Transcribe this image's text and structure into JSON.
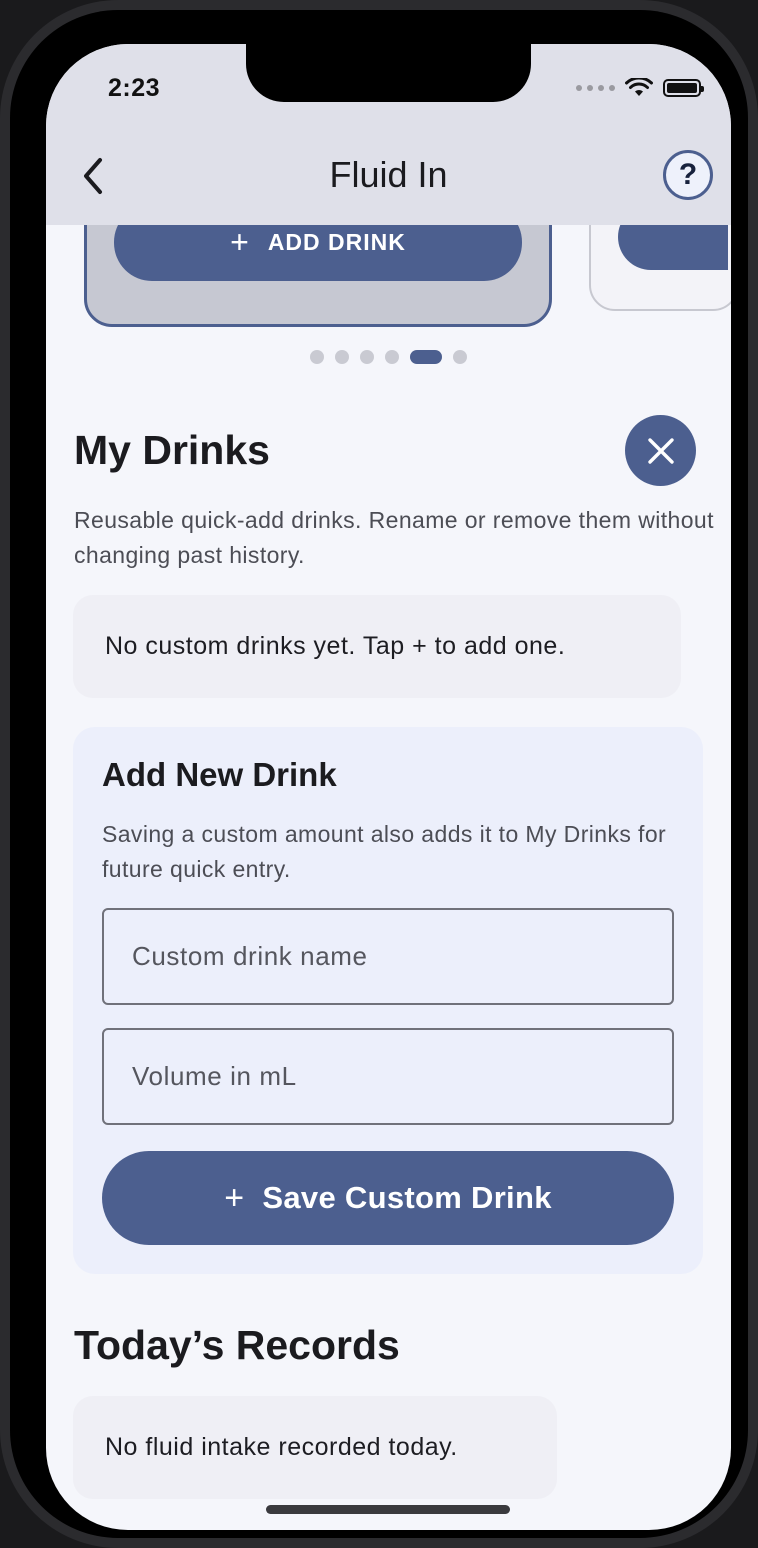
{
  "status_bar": {
    "time": "2:23"
  },
  "nav": {
    "title": "Fluid In",
    "help_label": "?"
  },
  "carousel": {
    "add_drink_label": "ADD DRINK",
    "plus": "+"
  },
  "my_drinks": {
    "title": "My Drinks",
    "description": "Reusable quick-add drinks. Rename or remove them without changing past history.",
    "empty_message": "No custom drinks yet. Tap + to add one."
  },
  "add_new_drink": {
    "title": "Add New Drink",
    "description": "Saving a custom amount also adds it to My Drinks for future quick entry.",
    "name_placeholder": "Custom drink name",
    "volume_placeholder": "Volume in mL",
    "save_label": "Save Custom Drink",
    "plus": "+"
  },
  "todays_records": {
    "title": "Today’s Records",
    "empty_message": "No fluid intake recorded today."
  },
  "colors": {
    "accent": "#4c5f8f",
    "header_bg": "#dfe0e9",
    "page_bg": "#f5f6fb"
  }
}
